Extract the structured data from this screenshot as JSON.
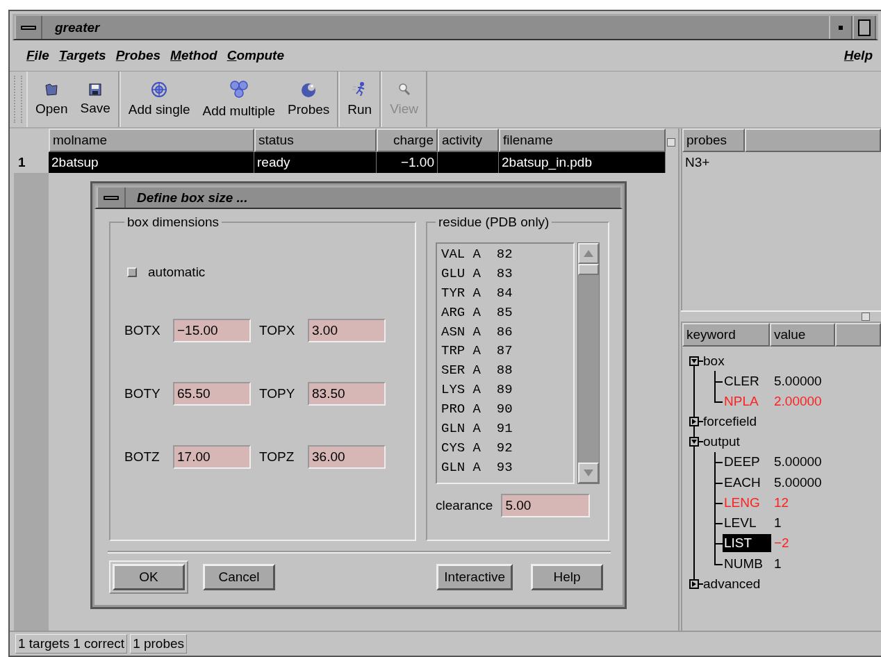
{
  "window": {
    "title": "greater"
  },
  "menu": [
    {
      "label": "File"
    },
    {
      "label": "Targets"
    },
    {
      "label": "Probes"
    },
    {
      "label": "Method"
    },
    {
      "label": "Compute"
    }
  ],
  "help_menu": {
    "label": "Help"
  },
  "toolbar": [
    [
      {
        "kind": "open",
        "label": "Open",
        "disabled": false
      },
      {
        "kind": "save",
        "label": "Save",
        "disabled": false
      }
    ],
    [
      {
        "kind": "single",
        "label": "Add single",
        "disabled": false
      },
      {
        "kind": "multiple",
        "label": "Add multiple",
        "disabled": false
      },
      {
        "kind": "probes",
        "label": "Probes",
        "disabled": false
      }
    ],
    [
      {
        "kind": "run",
        "label": "Run",
        "disabled": false
      }
    ],
    [
      {
        "kind": "view",
        "label": "View",
        "disabled": true
      }
    ]
  ],
  "table": {
    "columns": [
      "molname",
      "status",
      "charge",
      "activity",
      "filename"
    ],
    "rows": [
      {
        "number": "1",
        "cells": [
          "2batsup",
          "ready",
          "−1.00",
          "",
          "2batsup_in.pdb"
        ],
        "selected": true
      }
    ]
  },
  "probes": {
    "column": "probes",
    "items": [
      "N3+"
    ]
  },
  "keywords": {
    "columns": [
      "keyword",
      "value"
    ],
    "items": [
      {
        "name": "box",
        "expanded": true,
        "children": [
          {
            "name": "CLER",
            "value": "5.00000",
            "modified": false,
            "selected": false
          },
          {
            "name": "NPLA",
            "value": "2.00000",
            "modified": true,
            "selected": false
          }
        ]
      },
      {
        "name": "forcefield",
        "expanded": false
      },
      {
        "name": "output",
        "expanded": true,
        "children": [
          {
            "name": "DEEP",
            "value": "5.00000",
            "modified": false,
            "selected": false
          },
          {
            "name": "EACH",
            "value": "5.00000",
            "modified": false,
            "selected": false
          },
          {
            "name": "LENG",
            "value": "12",
            "modified": true,
            "selected": false
          },
          {
            "name": "LEVL",
            "value": "1",
            "modified": false,
            "selected": false
          },
          {
            "name": "LIST",
            "value": "−2",
            "modified": true,
            "selected": true
          },
          {
            "name": "NUMB",
            "value": "1",
            "modified": false,
            "selected": false
          }
        ]
      },
      {
        "name": "advanced",
        "expanded": false
      }
    ]
  },
  "dialog": {
    "title": "Define box size ...",
    "box_group": {
      "title": "box dimensions",
      "automatic": {
        "label": "automatic",
        "checked": false
      },
      "fields": [
        [
          {
            "label": "BOTX",
            "value": "−15.00"
          },
          {
            "label": "TOPX",
            "value": "3.00"
          }
        ],
        [
          {
            "label": "BOTY",
            "value": "65.50"
          },
          {
            "label": "TOPY",
            "value": "83.50"
          }
        ],
        [
          {
            "label": "BOTZ",
            "value": "17.00"
          },
          {
            "label": "TOPZ",
            "value": "36.00"
          }
        ]
      ]
    },
    "residue_group": {
      "title": "residue (PDB only)",
      "items": [
        "VAL A  82",
        "GLU A  83",
        "TYR A  84",
        "ARG A  85",
        "ASN A  86",
        "TRP A  87",
        "SER A  88",
        "LYS A  89",
        "PRO A  90",
        "GLN A  91",
        "CYS A  92",
        "GLN A  93"
      ],
      "clearance": {
        "label": "clearance",
        "value": "5.00"
      }
    },
    "buttons_left": [
      {
        "label": "OK",
        "default": true
      },
      {
        "label": "Cancel",
        "default": false
      }
    ],
    "buttons_right": [
      {
        "label": "Interactive",
        "default": false
      },
      {
        "label": "Help",
        "default": false
      }
    ]
  },
  "status_bar": [
    "1 targets 1 correct",
    "1 probes"
  ]
}
